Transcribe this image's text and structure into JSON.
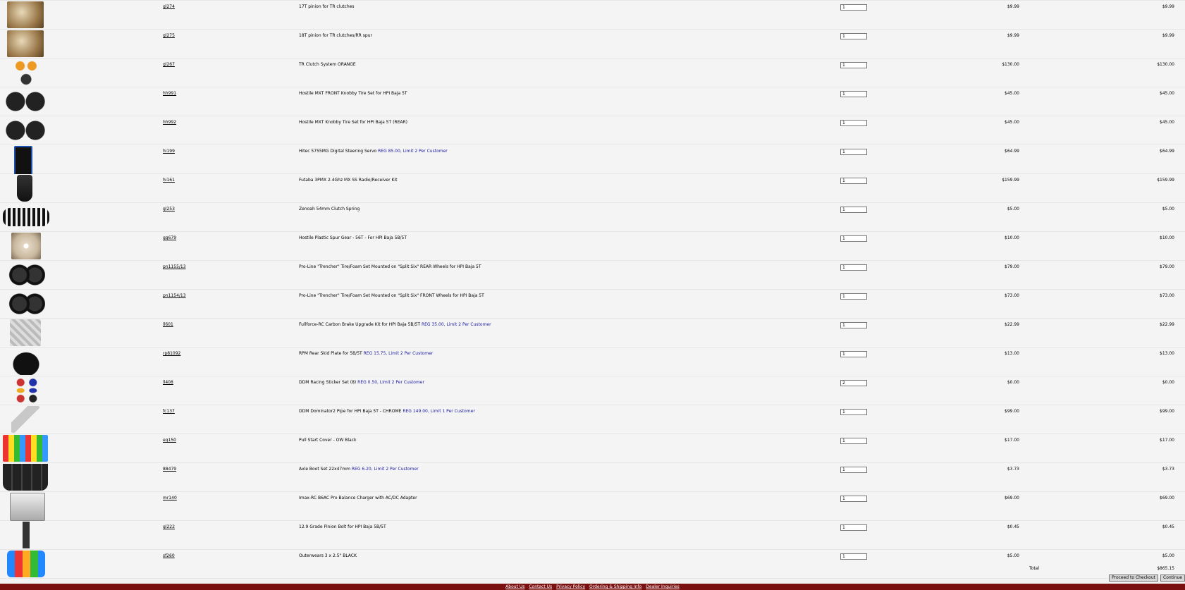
{
  "items": [
    {
      "img": "metal",
      "sku": "gl274",
      "desc": "17T pinion for TR clutches",
      "note": "",
      "qty": "1",
      "price": "$9.99",
      "ext": "$9.99"
    },
    {
      "img": "metal",
      "sku": "gl275",
      "desc": "18T pinion for TR clutches/RR spur",
      "note": "",
      "qty": "1",
      "price": "$9.99",
      "ext": "$9.99"
    },
    {
      "img": "clutch",
      "sku": "gl267",
      "desc": "TR Clutch System ORANGE",
      "note": "",
      "qty": "1",
      "price": "$130.00",
      "ext": "$130.00"
    },
    {
      "img": "tire",
      "sku": "hh991",
      "desc": "Hostile MXT FRONT Knobby Tire Set for HPI Baja 5T",
      "note": "",
      "qty": "1",
      "price": "$45.00",
      "ext": "$45.00"
    },
    {
      "img": "tire",
      "sku": "hh992",
      "desc": "Hostile MXT Knobby Tire Set for HPI Baja 5T (REAR)",
      "note": "",
      "qty": "1",
      "price": "$45.00",
      "ext": "$45.00"
    },
    {
      "img": "servo",
      "sku": "hi199",
      "desc": "Hitec 5755MG Digital Steering Servo",
      "note": "REG 85.00, Limit 2 Per Customer",
      "qty": "1",
      "price": "$64.99",
      "ext": "$64.99"
    },
    {
      "img": "radio",
      "sku": "hi161",
      "desc": "Futaba 3PMX 2.4Ghz MX SS Radio/Receiver Kit",
      "note": "",
      "qty": "1",
      "price": "$159.99",
      "ext": "$159.99"
    },
    {
      "img": "spring",
      "sku": "gl253",
      "desc": "Zenoah 54mm Clutch Spring",
      "note": "",
      "qty": "1",
      "price": "$5.00",
      "ext": "$5.00"
    },
    {
      "img": "gear",
      "sku": "gg679",
      "desc": "Hostile Plastic Spur Gear - 56T - For HPI Baja 5B/5T",
      "note": "",
      "qty": "1",
      "price": "$10.00",
      "ext": "$10.00"
    },
    {
      "img": "wheel",
      "sku": "pn1155/13",
      "desc": "Pro-Line \"Trencher\" Tire/Foam Set Mounted on \"Split Six\" REAR Wheels for HPI Baja 5T",
      "note": "",
      "qty": "1",
      "price": "$79.00",
      "ext": "$79.00"
    },
    {
      "img": "wheel",
      "sku": "pn1154/13",
      "desc": "Pro-Line \"Trencher\" Tire/Foam Set Mounted on \"Split Six\" FRONT Wheels for HPI Baja 5T",
      "note": "",
      "qty": "1",
      "price": "$73.00",
      "ext": "$73.00"
    },
    {
      "img": "parts",
      "sku": "ll601",
      "desc": "Fullforce-RC Carbon Brake Upgrade Kit for HPI Baja 5B/5T",
      "note": "REG 35.00, Limit 2 Per Customer",
      "qty": "1",
      "price": "$22.99",
      "ext": "$22.99"
    },
    {
      "img": "plate",
      "sku": "rp81092",
      "desc": "RPM Rear Skid Plate for 5B/5T",
      "note": "REG 15.75, Limit 2 Per Customer",
      "qty": "1",
      "price": "$13.00",
      "ext": "$13.00"
    },
    {
      "img": "sticker",
      "sku": "ll408",
      "desc": "DDM Racing Sticker Set (8)",
      "note": "REG 0.50, Limit 2 Per Customer",
      "qty": "2",
      "price": "$0.00",
      "ext": "$0.00"
    },
    {
      "img": "pipe",
      "sku": "fc137",
      "desc": "DDM Dominator2 Pipe for HPI Baja 5T - CHROME",
      "note": "REG 149.00, Limit 1 Per Customer",
      "qty": "1",
      "price": "$99.00",
      "ext": "$99.00"
    },
    {
      "img": "covers",
      "sku": "eg150",
      "desc": "Pull Start Cover - OW Black",
      "note": "",
      "qty": "1",
      "price": "$17.00",
      "ext": "$17.00"
    },
    {
      "img": "boots",
      "sku": "88479",
      "desc": "Axle Boot Set 22x47mm",
      "note": "REG 6.20, Limit 2 Per Customer",
      "qty": "1",
      "price": "$3.73",
      "ext": "$3.73"
    },
    {
      "img": "charger",
      "sku": "mr140",
      "desc": "Imax-RC B6AC Pro Balance Charger with AC/DC Adapter",
      "note": "",
      "qty": "1",
      "price": "$69.00",
      "ext": "$69.00"
    },
    {
      "img": "bolt",
      "sku": "gl222",
      "desc": "12.9 Grade Pinion Bolt for HPI Baja 5B/5T",
      "note": "",
      "qty": "1",
      "price": "$0.45",
      "ext": "$0.45"
    },
    {
      "img": "outer",
      "sku": "sf260",
      "desc": "Outerwears 3 x 2.5\" BLACK",
      "note": "",
      "qty": "1",
      "price": "$5.00",
      "ext": "$5.00"
    }
  ],
  "summary": {
    "label": "Total",
    "value": "$865.15"
  },
  "buttons": {
    "checkout": "Proceed to Checkout",
    "continue": "Continue"
  },
  "footer": {
    "links": [
      "About Us",
      "Contact Us",
      "Privacy Policy",
      "Ordering & Shipping Info",
      "Dealer Inquiries"
    ]
  }
}
